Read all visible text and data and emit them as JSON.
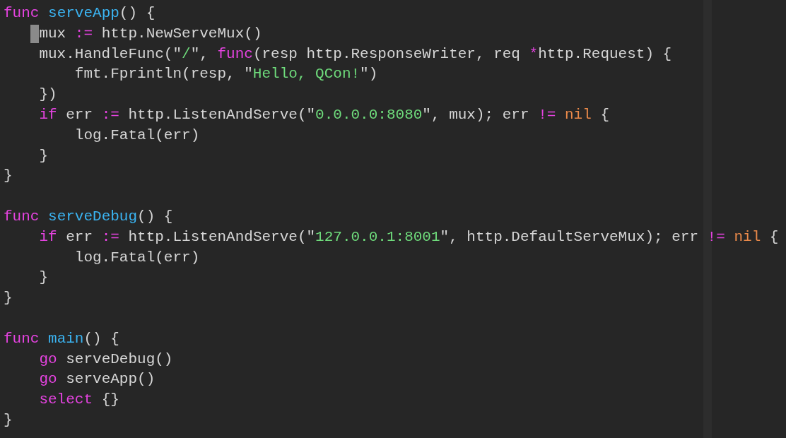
{
  "editor": {
    "lines": [
      {
        "cursor": false,
        "tokens": [
          {
            "kind": "keyword",
            "text": "func"
          },
          {
            "kind": "function",
            "text": " serveApp"
          },
          {
            "kind": "plain",
            "text": "() {"
          }
        ],
        "children": [
          {
            "cursor": true,
            "tokens": [
              {
                "kind": "plain",
                "text": "mux "
              },
              {
                "kind": "keyword",
                "text": ":="
              },
              {
                "kind": "plain",
                "text": " http.NewServeMux()"
              }
            ]
          },
          {
            "cursor": false,
            "tokens": [
              {
                "kind": "plain",
                "text": "mux.HandleFunc(\""
              },
              {
                "kind": "string",
                "text": "/"
              },
              {
                "kind": "plain",
                "text": "\", "
              },
              {
                "kind": "keyword",
                "text": "func"
              },
              {
                "kind": "plain",
                "text": "(resp http.ResponseWriter, req "
              },
              {
                "kind": "keyword",
                "text": "*"
              },
              {
                "kind": "plain",
                "text": "http.Request) {"
              }
            ],
            "children": [
              {
                "cursor": false,
                "tokens": [
                  {
                    "kind": "plain",
                    "text": "fmt.Fprintln(resp, \""
                  },
                  {
                    "kind": "string",
                    "text": "Hello, QCon!"
                  },
                  {
                    "kind": "plain",
                    "text": "\")"
                  }
                ]
              }
            ]
          },
          {
            "cursor": false,
            "tokens": [
              {
                "kind": "plain",
                "text": "})"
              }
            ]
          },
          {
            "cursor": false,
            "tokens": [
              {
                "kind": "keyword",
                "text": "if"
              },
              {
                "kind": "plain",
                "text": " err "
              },
              {
                "kind": "keyword",
                "text": ":="
              },
              {
                "kind": "plain",
                "text": " http.ListenAndServe(\""
              },
              {
                "kind": "string",
                "text": "0.0.0.0:8080"
              },
              {
                "kind": "plain",
                "text": "\", mux); err "
              },
              {
                "kind": "keyword",
                "text": "!="
              },
              {
                "kind": "constant",
                "text": " nil"
              },
              {
                "kind": "plain",
                "text": " {"
              }
            ],
            "children": [
              {
                "cursor": false,
                "tokens": [
                  {
                    "kind": "plain",
                    "text": "log.Fatal(err)"
                  }
                ]
              }
            ]
          },
          {
            "cursor": false,
            "tokens": [
              {
                "kind": "plain",
                "text": "}"
              }
            ]
          }
        ]
      },
      {
        "cursor": false,
        "tokens": [
          {
            "kind": "plain",
            "text": "}"
          }
        ]
      },
      {
        "cursor": false
      },
      {
        "cursor": false,
        "tokens": [
          {
            "kind": "keyword",
            "text": "func"
          },
          {
            "kind": "function",
            "text": " serveDebug"
          },
          {
            "kind": "plain",
            "text": "() {"
          }
        ],
        "children": [
          {
            "cursor": false,
            "tokens": [
              {
                "kind": "keyword",
                "text": "if"
              },
              {
                "kind": "plain",
                "text": " err "
              },
              {
                "kind": "keyword",
                "text": ":="
              },
              {
                "kind": "plain",
                "text": " http.ListenAndServe(\""
              },
              {
                "kind": "string",
                "text": "127.0.0.1:8001"
              },
              {
                "kind": "plain",
                "text": "\", http.DefaultServeMux); err "
              },
              {
                "kind": "keyword",
                "text": "!="
              },
              {
                "kind": "constant",
                "text": " nil"
              },
              {
                "kind": "plain",
                "text": " {"
              }
            ],
            "children": [
              {
                "cursor": false,
                "tokens": [
                  {
                    "kind": "plain",
                    "text": "log.Fatal(err)"
                  }
                ]
              }
            ]
          },
          {
            "cursor": false,
            "tokens": [
              {
                "kind": "plain",
                "text": "}"
              }
            ]
          }
        ]
      },
      {
        "cursor": false,
        "tokens": [
          {
            "kind": "plain",
            "text": "}"
          }
        ]
      },
      {
        "cursor": false
      },
      {
        "cursor": false,
        "tokens": [
          {
            "kind": "keyword",
            "text": "func"
          },
          {
            "kind": "function",
            "text": " main"
          },
          {
            "kind": "plain",
            "text": "() {"
          }
        ],
        "children": [
          {
            "cursor": false,
            "tokens": [
              {
                "kind": "keyword",
                "text": "go"
              },
              {
                "kind": "plain",
                "text": " serveDebug()"
              }
            ]
          },
          {
            "cursor": false,
            "tokens": [
              {
                "kind": "keyword",
                "text": "go"
              },
              {
                "kind": "plain",
                "text": " serveApp()"
              }
            ]
          },
          {
            "cursor": false,
            "tokens": [
              {
                "kind": "keyword",
                "text": "select"
              },
              {
                "kind": "plain",
                "text": " {}"
              }
            ]
          }
        ]
      },
      {
        "cursor": false,
        "tokens": [
          {
            "kind": "plain",
            "text": "}"
          }
        ]
      }
    ]
  }
}
